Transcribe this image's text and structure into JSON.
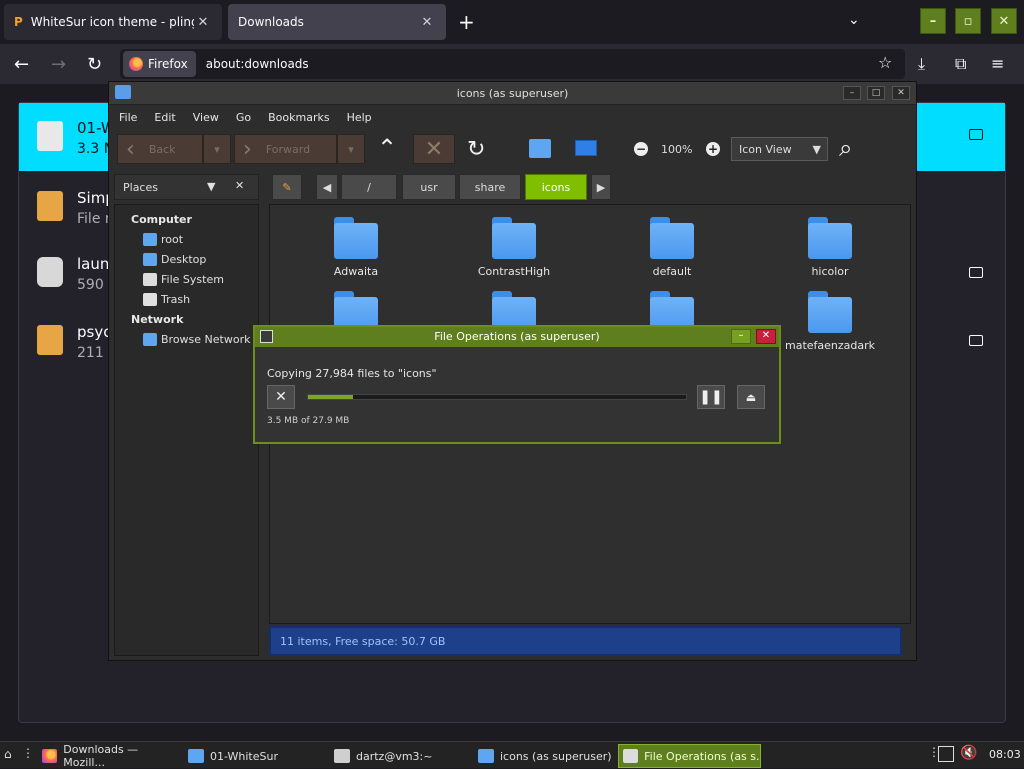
{
  "browser": {
    "tabs": [
      {
        "title": "WhiteSur icon theme - pling.com"
      },
      {
        "title": "Downloads"
      }
    ],
    "identity_label": "Firefox",
    "url": "about:downloads"
  },
  "downloads": [
    {
      "name": "01-W",
      "meta": "3.3 M",
      "selected": true
    },
    {
      "name": "Simp",
      "meta": "File r",
      "selected": false
    },
    {
      "name": "laun",
      "meta": "590",
      "selected": false
    },
    {
      "name": "psyc",
      "meta": "211 M",
      "selected": false
    }
  ],
  "file_manager": {
    "title": "icons (as superuser)",
    "menu": [
      "File",
      "Edit",
      "View",
      "Go",
      "Bookmarks",
      "Help"
    ],
    "toolbar": {
      "back": "Back",
      "forward": "Forward",
      "zoom": "100%",
      "view_mode": "Icon View"
    },
    "places_label": "Places",
    "sidebar": {
      "computer_heading": "Computer",
      "computer_items": [
        "root",
        "Desktop",
        "File System",
        "Trash"
      ],
      "network_heading": "Network",
      "network_items": [
        "Browse Network"
      ]
    },
    "path": [
      "/",
      "usr",
      "share",
      "icons"
    ],
    "folders": [
      "Adwaita",
      "ContrastHigh",
      "default",
      "hicolor",
      "",
      "",
      "",
      "matefaenzadark"
    ],
    "status": "11 items, Free space: 50.7 GB"
  },
  "file_operations": {
    "title": "File Operations (as superuser)",
    "message": "Copying 27,984 files to \"icons\"",
    "progress_fraction": 0.12,
    "detail": "3.5 MB of 27.9 MB"
  },
  "taskbar": {
    "items": [
      "Downloads — Mozill...",
      "01-WhiteSur",
      "dartz@vm3:~",
      "icons (as superuser)",
      "File Operations (as s..."
    ],
    "clock": "08:03"
  },
  "colors": {
    "accent": "#00ddff",
    "mate_green": "#5f7f1e",
    "folder_blue": "#4a98ef"
  }
}
